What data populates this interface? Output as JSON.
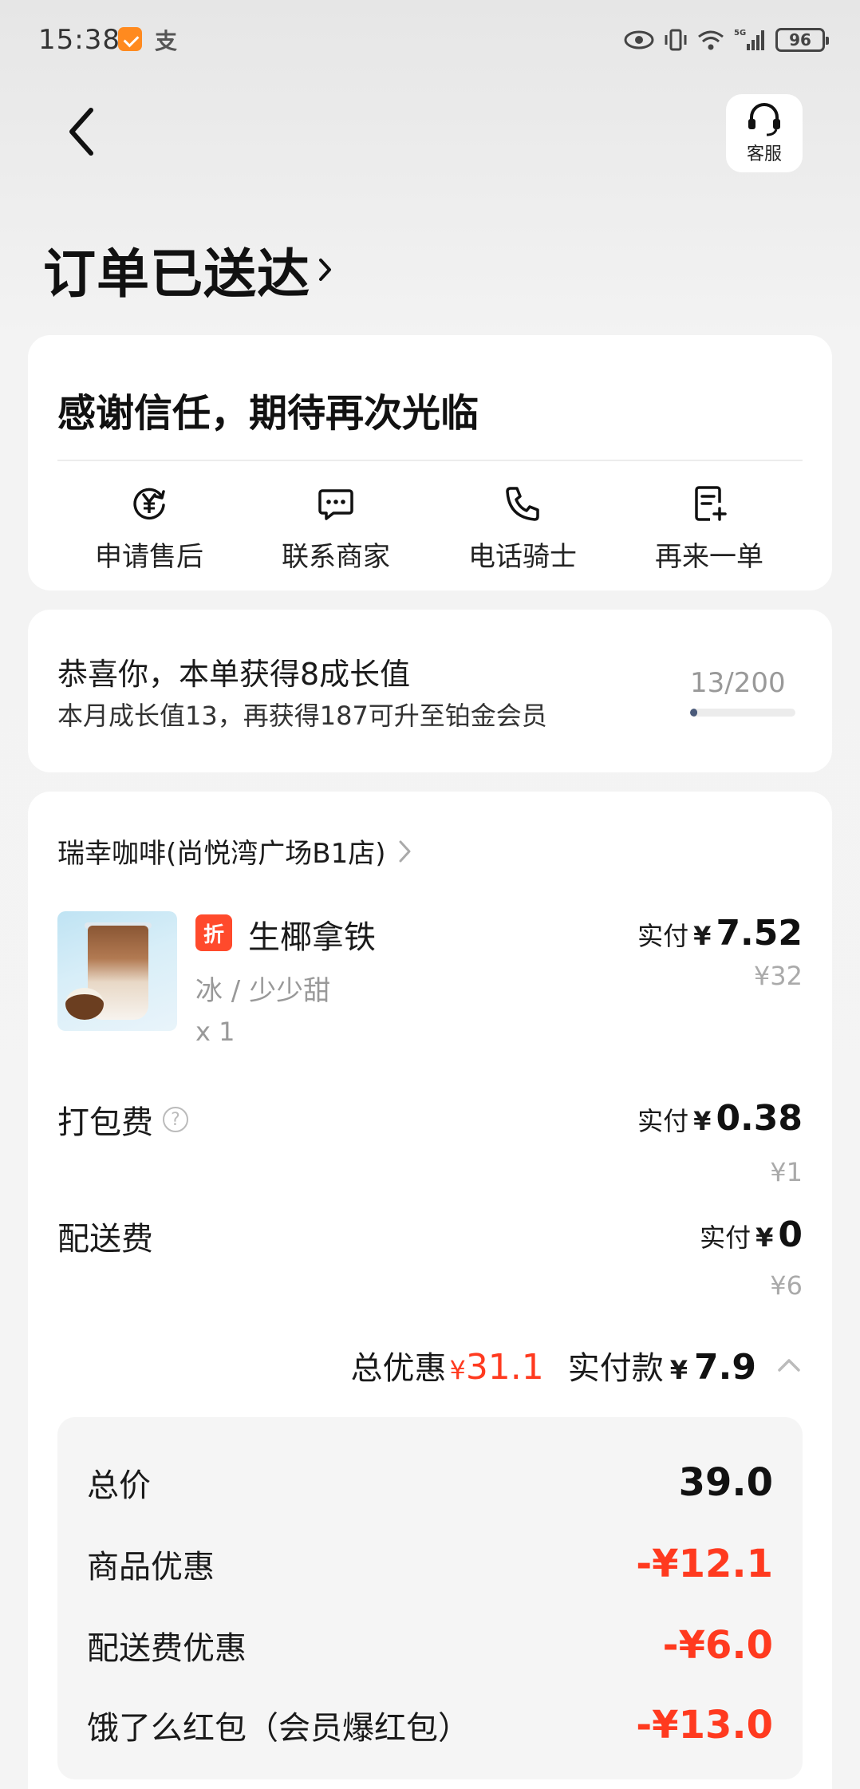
{
  "status_bar": {
    "time": "15:38",
    "alipay_glyph": "支",
    "network": "5G",
    "battery": "96"
  },
  "header": {
    "title": "订单已送达",
    "customer_service_label": "客服"
  },
  "thanks_card": {
    "message": "感谢信任，期待再次光临",
    "actions": [
      {
        "label": "申请售后",
        "icon": "refund-yen-icon"
      },
      {
        "label": "联系商家",
        "icon": "chat-icon"
      },
      {
        "label": "电话骑士",
        "icon": "phone-icon"
      },
      {
        "label": "再来一单",
        "icon": "reorder-icon"
      }
    ]
  },
  "growth_card": {
    "title": "恭喜你，本单获得8成长值",
    "subtitle": "本月成长值13，再获得187可升至铂金会员",
    "progress_text": "13/200",
    "progress_fraction": 0.065
  },
  "order": {
    "store_name": "瑞幸咖啡(尚悦湾广场B1店)",
    "product": {
      "discount_tag": "折",
      "name": "生椰拿铁",
      "spec": "冰 / 少少甜",
      "quantity": "x 1",
      "paid_label": "实付",
      "currency": "¥",
      "paid_amount": "7.52",
      "original_price": "¥32"
    },
    "packing_fee": {
      "label": "打包费",
      "paid_label": "实付",
      "currency": "¥",
      "paid_amount": "0.38",
      "original_price": "¥1"
    },
    "delivery_fee": {
      "label": "配送费",
      "paid_label": "实付",
      "currency": "¥",
      "paid_amount": "0",
      "original_price": "¥6"
    },
    "summary": {
      "discount_label": "总优惠",
      "discount_currency": "¥",
      "discount_amount": "31.1",
      "paid_label": "实付款",
      "paid_currency": "¥",
      "paid_amount": "7.9"
    },
    "breakdown": [
      {
        "label": "总价",
        "value": "39.0"
      },
      {
        "label": "商品优惠",
        "value": "-¥12.1"
      },
      {
        "label": "配送费优惠",
        "value": "-¥6.0"
      },
      {
        "label": "饿了么红包（会员爆红包）",
        "value": "-¥13.0"
      }
    ]
  },
  "colors": {
    "accent_red": "#ff3a1f",
    "tag_red": "#ff4a2c",
    "progress_fill": "#4a5a7a"
  }
}
